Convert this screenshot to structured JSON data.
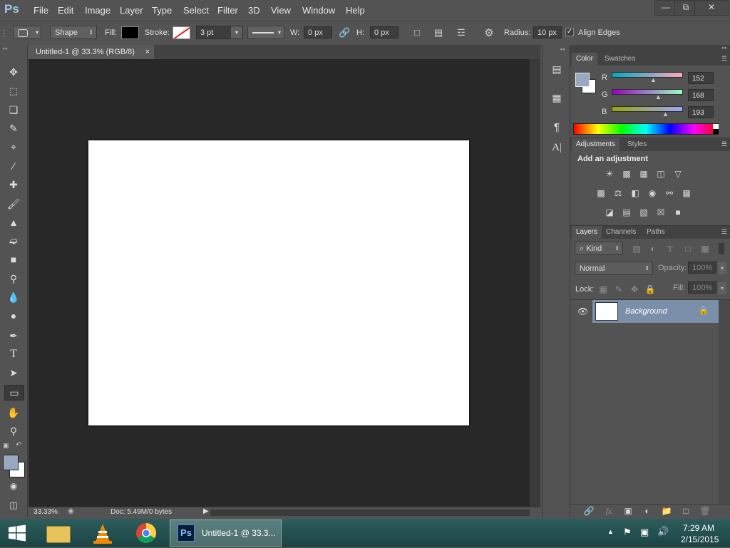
{
  "app": {
    "logo": "Ps",
    "menu": [
      "File",
      "Edit",
      "Image",
      "Layer",
      "Type",
      "Select",
      "Filter",
      "3D",
      "View",
      "Window",
      "Help"
    ],
    "window_controls": {
      "minimize": "—",
      "restore": "⧉",
      "close": "✕"
    }
  },
  "options": {
    "shape_mode": "Shape",
    "fill_label": "Fill:",
    "stroke_label": "Stroke:",
    "stroke_width": "3 pt",
    "w_label": "W:",
    "w_value": "0 px",
    "h_label": "H:",
    "h_value": "0 px",
    "radius_label": "Radius:",
    "radius_value": "10 px",
    "align_edges": "Align Edges",
    "align_edges_checked": true
  },
  "document": {
    "tab_title": "Untitled-1 @ 33.3% (RGB/8)",
    "tab_close": "×",
    "zoom": "33.33%",
    "doc_info": "Doc: 5.49M/0 bytes"
  },
  "color_panel": {
    "tabs": [
      "Color",
      "Swatches"
    ],
    "fg_color": "#98a8c1",
    "channels": [
      {
        "label": "R",
        "value": "152"
      },
      {
        "label": "G",
        "value": "168"
      },
      {
        "label": "B",
        "value": "193"
      }
    ]
  },
  "adjustments_panel": {
    "tabs": [
      "Adjustments",
      "Styles"
    ],
    "heading": "Add an adjustment"
  },
  "layers_panel": {
    "tabs": [
      "Layers",
      "Channels",
      "Paths"
    ],
    "filter_kind": "⌕ Kind",
    "blend_mode": "Normal",
    "opacity_label": "Opacity:",
    "opacity_value": "100%",
    "lock_label": "Lock:",
    "fill_label": "Fill:",
    "fill_value": "100%",
    "layers": [
      {
        "name": "Background",
        "visible": true,
        "locked": true
      }
    ]
  },
  "taskbar": {
    "active_window": "Untitled-1 @ 33.3...",
    "time": "7:29 AM",
    "date": "2/15/2015"
  }
}
